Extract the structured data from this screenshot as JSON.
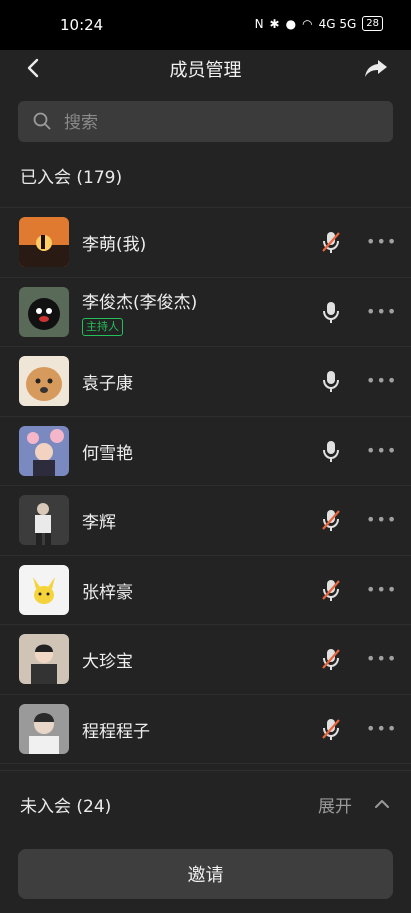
{
  "status_bar": {
    "time": "10:24",
    "battery": "28",
    "network": "4G 5G"
  },
  "header": {
    "title": "成员管理"
  },
  "search": {
    "placeholder": "搜索"
  },
  "joined": {
    "title": "已入会 (179)"
  },
  "members": [
    {
      "name": "李萌(我)",
      "host": false,
      "muted": true,
      "avatar_color": "#c46a2a"
    },
    {
      "name": "李俊杰(李俊杰)",
      "host": true,
      "host_label": "主持人",
      "muted": false,
      "avatar_color": "#2a2a2a"
    },
    {
      "name": "袁子康",
      "host": false,
      "muted": false,
      "avatar_color": "#d29a5a"
    },
    {
      "name": "何雪艳",
      "host": false,
      "muted": false,
      "avatar_color": "#5e6ea0"
    },
    {
      "name": "李辉",
      "host": false,
      "muted": true,
      "avatar_color": "#4a4a4a"
    },
    {
      "name": "张梓豪",
      "host": false,
      "muted": true,
      "avatar_color": "#f2f2f2"
    },
    {
      "name": "大珍宝",
      "host": false,
      "muted": true,
      "avatar_color": "#a08a76"
    },
    {
      "name": "程程程子",
      "host": false,
      "muted": true,
      "avatar_color": "#6b6b6b"
    }
  ],
  "more_label": "•••",
  "not_joined": {
    "title": "未入会 (24)",
    "expand_label": "展开"
  },
  "invite_button": {
    "label": "邀请"
  },
  "colors": {
    "background": "#232323",
    "host_tag": "#25c05a",
    "muted_slash": "#e8643c"
  }
}
